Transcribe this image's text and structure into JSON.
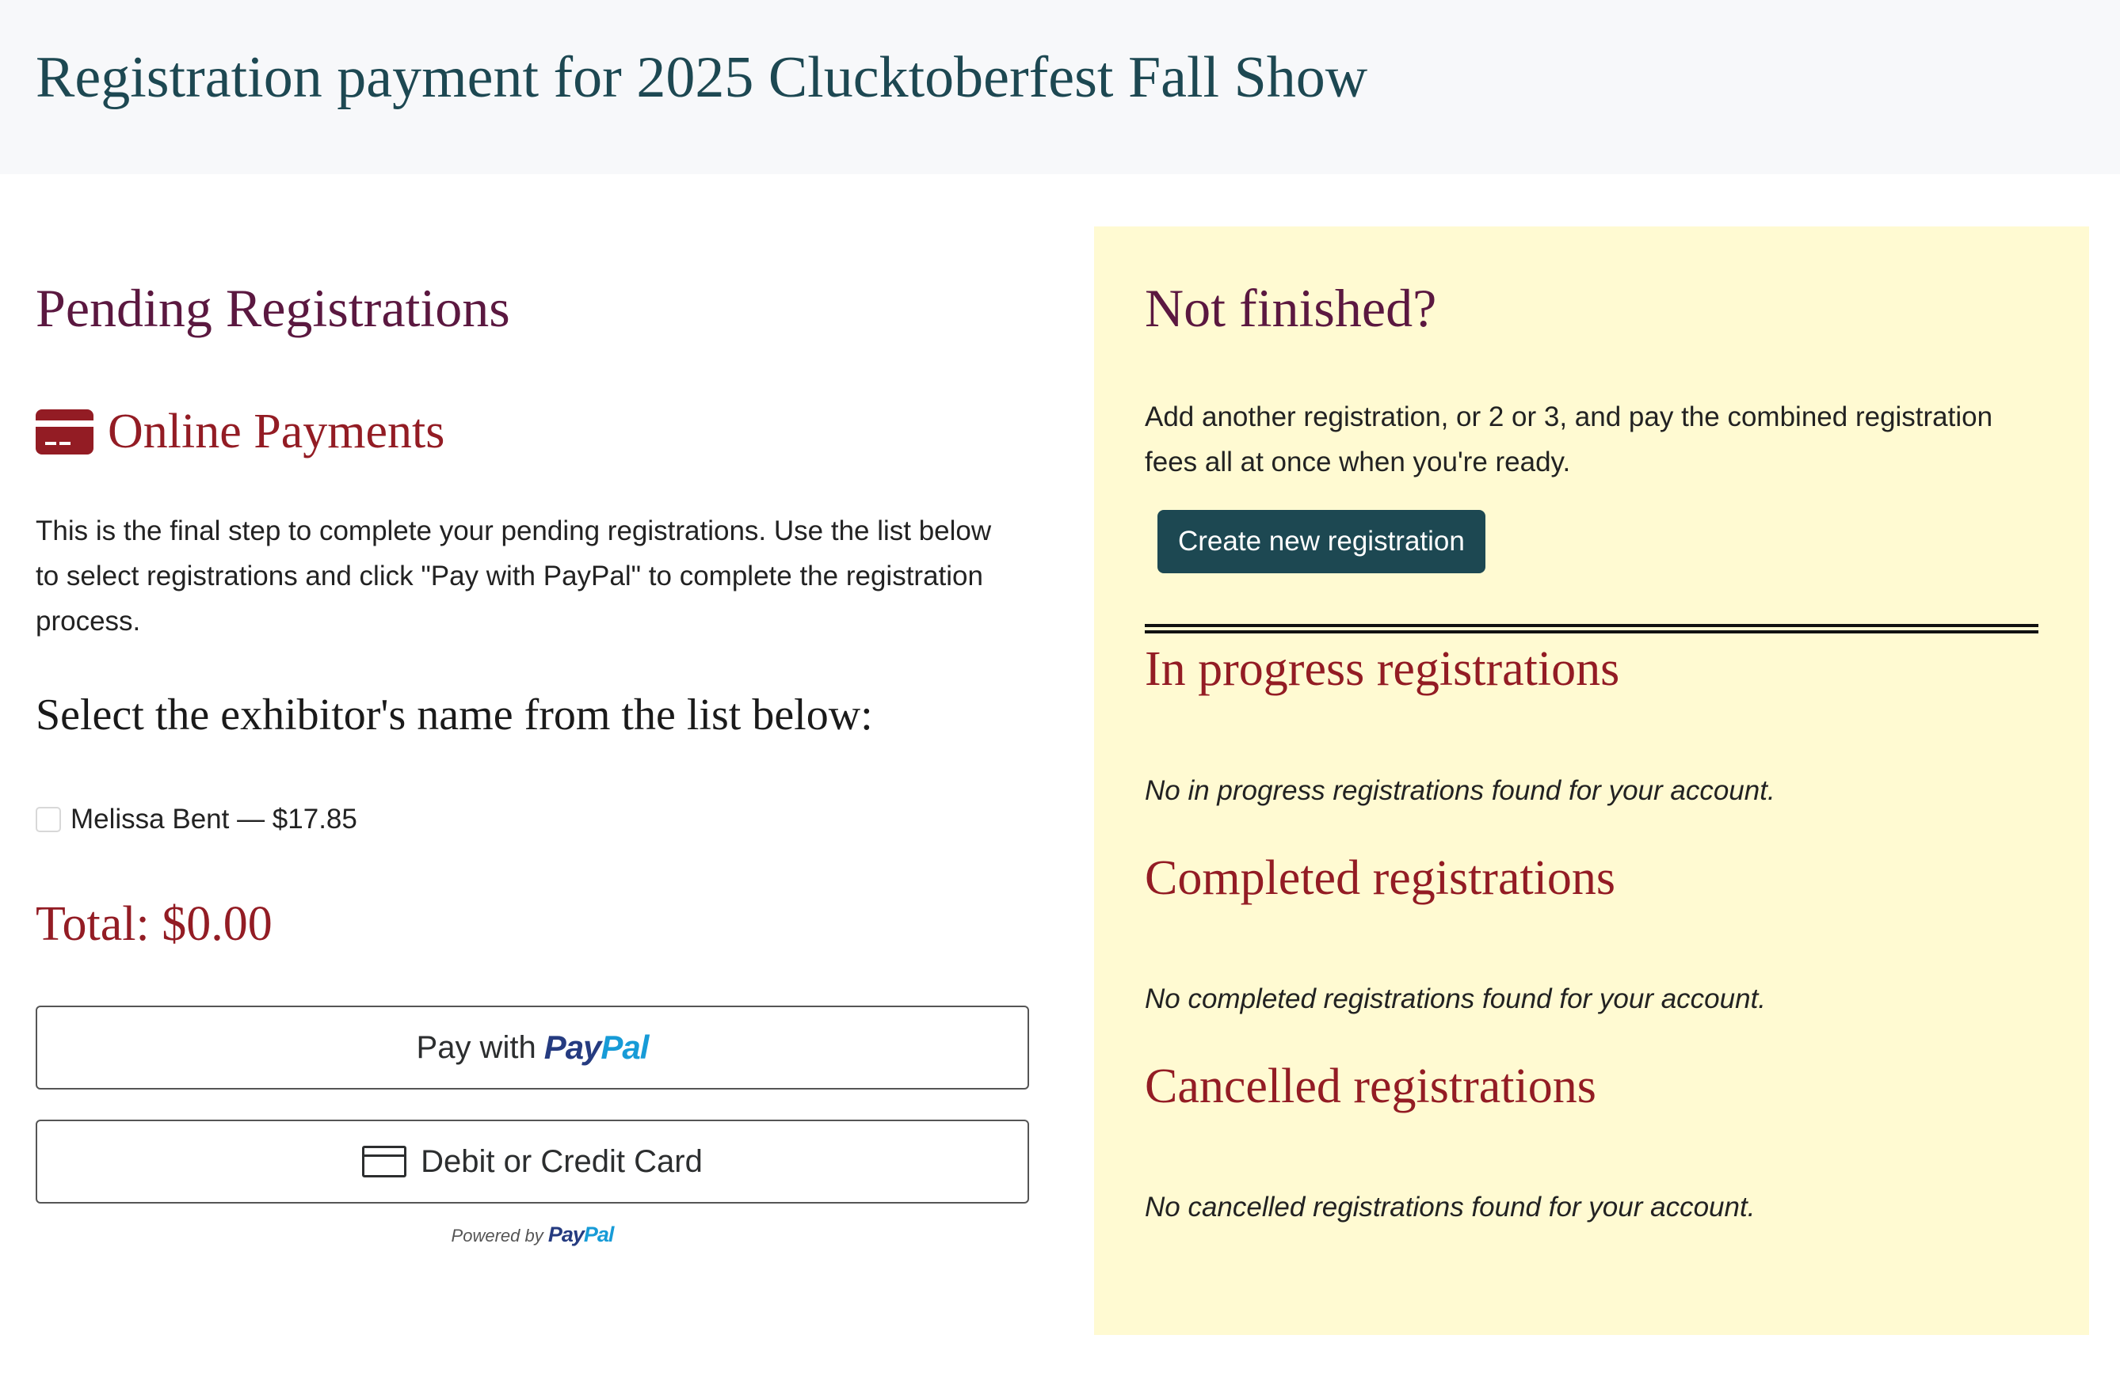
{
  "header": {
    "title": "Registration payment for 2025 Clucktoberfest Fall Show"
  },
  "left": {
    "pending_title": "Pending Registrations",
    "online_title": "Online Payments",
    "intro": "This is the final step to complete your pending registrations. Use the list below to select registrations and click \"Pay with PayPal\" to complete the registration process.",
    "select_title": "Select the exhibitor's name from the list below:",
    "exhibitors": [
      {
        "label": "Melissa Bent — $17.85",
        "checked": false
      }
    ],
    "total": "Total: $0.00",
    "paypal_button": {
      "prefix": "Pay with",
      "logo_pay": "Pay",
      "logo_pal": "Pal"
    },
    "card_button": {
      "label": "Debit or Credit Card"
    },
    "powered": {
      "label": "Powered by",
      "logo_pay": "Pay",
      "logo_pal": "Pal"
    }
  },
  "right": {
    "title": "Not finished?",
    "text": "Add another registration, or 2 or 3, and pay the combined registration fees all at once when you're ready.",
    "create_button": "Create new registration",
    "sections": {
      "in_progress": {
        "title": "In progress registrations",
        "empty": "No in progress registrations found for your account."
      },
      "completed": {
        "title": "Completed registrations",
        "empty": "No completed registrations found for your account."
      },
      "cancelled": {
        "title": "Cancelled registrations",
        "empty": "No cancelled registrations found for your account."
      }
    }
  },
  "colors": {
    "header_text": "#1d4852",
    "heading_plum": "#5b1840",
    "accent_red": "#931c24",
    "panel_bg": "#fffad2",
    "button_teal": "#1d4852",
    "paypal_dark": "#253b80",
    "paypal_light": "#179bd7"
  },
  "icons": {
    "online_payments": "credit-card-icon",
    "card_button": "card-outline-icon"
  }
}
